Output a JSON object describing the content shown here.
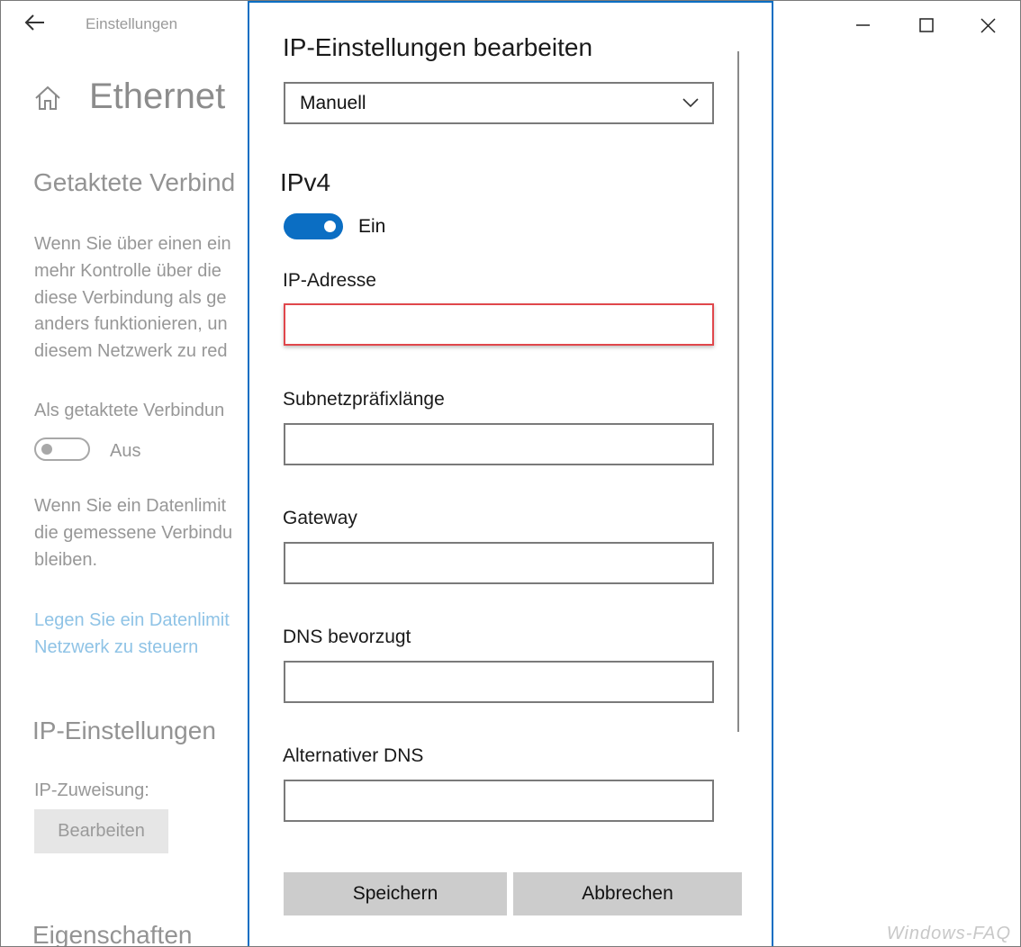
{
  "app": {
    "title": "Einstellungen",
    "page_title": "Ethernet"
  },
  "background": {
    "metered_heading": "Getaktete Verbind",
    "metered_para": [
      "Wenn Sie über einen ein",
      "mehr Kontrolle über die",
      "diese Verbindung als ge",
      "anders funktionieren, un",
      "diesem Netzwerk zu red"
    ],
    "metered_toggle_label": "Als getaktete Verbindun",
    "metered_toggle_state": "Aus",
    "limit_para": [
      "Wenn Sie ein Datenlimit",
      "die gemessene Verbindu",
      "bleiben."
    ],
    "limit_link": [
      "Legen Sie ein Datenlimit",
      "Netzwerk zu steuern"
    ],
    "ip_heading": "IP-Einstellungen",
    "ip_assignment_label": "IP-Zuweisung:",
    "edit_button": "Bearbeiten",
    "properties_heading": "Eigenschaften"
  },
  "dialog": {
    "title": "IP-Einstellungen bearbeiten",
    "mode_select": "Manuell",
    "section": "IPv4",
    "ipv4_toggle_state": "Ein",
    "fields": {
      "ip_address": {
        "label": "IP-Adresse",
        "value": ""
      },
      "subnet_prefix": {
        "label": "Subnetzpräfixlänge",
        "value": ""
      },
      "gateway": {
        "label": "Gateway",
        "value": ""
      },
      "dns_preferred": {
        "label": "DNS bevorzugt",
        "value": ""
      },
      "dns_alternate": {
        "label": "Alternativer DNS",
        "value": ""
      }
    },
    "save_button": "Speichern",
    "cancel_button": "Abbrechen"
  },
  "watermark": "Windows-FAQ",
  "colors": {
    "accent": "#0b6ec3",
    "highlight_border": "#e0474c",
    "link": "#8fc3e6"
  }
}
